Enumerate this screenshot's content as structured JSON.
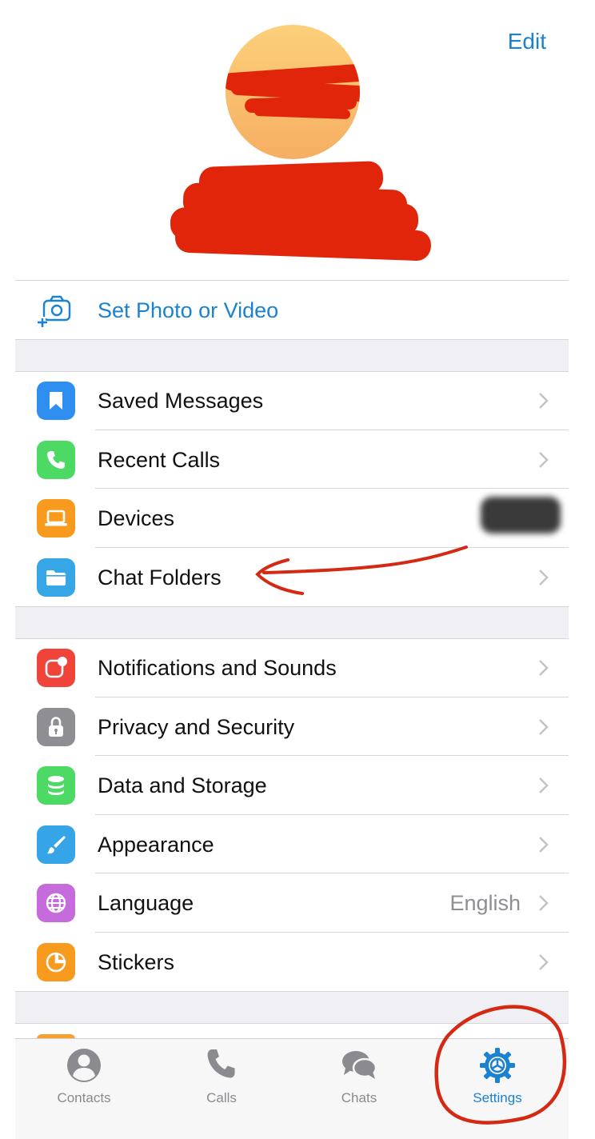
{
  "header": {
    "edit_label": "Edit"
  },
  "profile": {
    "set_photo_label": "Set Photo or Video"
  },
  "groups": [
    {
      "items": [
        {
          "key": "saved-messages",
          "label": "Saved Messages",
          "icon": "bookmark-icon",
          "color": "#2f8ff0",
          "value": ""
        },
        {
          "key": "recent-calls",
          "label": "Recent Calls",
          "icon": "phone-icon",
          "color": "#4cd964",
          "value": ""
        },
        {
          "key": "devices",
          "label": "Devices",
          "icon": "laptop-icon",
          "color": "#f79a1e",
          "value": ""
        },
        {
          "key": "chat-folders",
          "label": "Chat Folders",
          "icon": "folder-icon",
          "color": "#37a6e6",
          "value": ""
        }
      ]
    },
    {
      "items": [
        {
          "key": "notifications",
          "label": "Notifications and Sounds",
          "icon": "notification-icon",
          "color": "#f0443a",
          "value": ""
        },
        {
          "key": "privacy",
          "label": "Privacy and Security",
          "icon": "lock-icon",
          "color": "#8e8e93",
          "value": ""
        },
        {
          "key": "data-storage",
          "label": "Data and Storage",
          "icon": "database-icon",
          "color": "#4cd964",
          "value": ""
        },
        {
          "key": "appearance",
          "label": "Appearance",
          "icon": "brush-icon",
          "color": "#36a5e8",
          "value": ""
        },
        {
          "key": "language",
          "label": "Language",
          "icon": "globe-icon",
          "color": "#c66bdc",
          "value": "English"
        },
        {
          "key": "stickers",
          "label": "Stickers",
          "icon": "sticker-icon",
          "color": "#f89a1e",
          "value": ""
        }
      ]
    }
  ],
  "tabbar": {
    "tabs": [
      {
        "key": "contacts",
        "label": "Contacts",
        "icon": "person-icon",
        "active": false
      },
      {
        "key": "calls",
        "label": "Calls",
        "icon": "phone-icon",
        "active": false
      },
      {
        "key": "chats",
        "label": "Chats",
        "icon": "chat-bubbles-icon",
        "active": false
      },
      {
        "key": "settings",
        "label": "Settings",
        "icon": "gear-icon",
        "active": true
      }
    ]
  },
  "colors": {
    "accent": "#1a82d0",
    "annotation": "#d42a14",
    "inactive_tab": "#8a8a8f"
  }
}
